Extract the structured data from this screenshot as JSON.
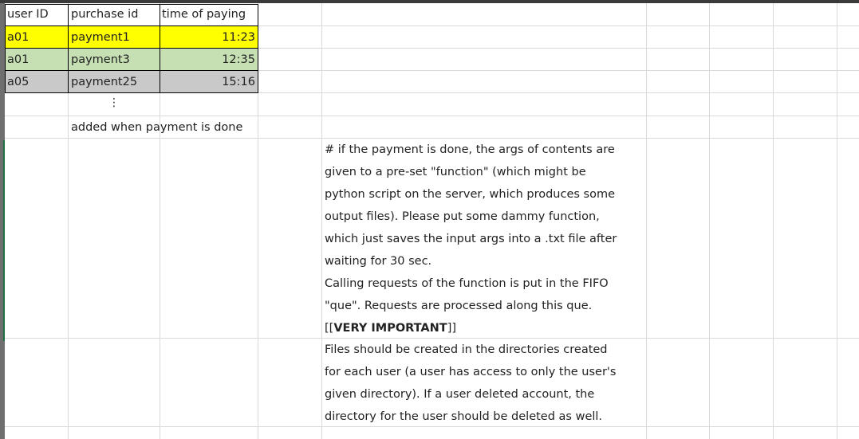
{
  "table": {
    "headers": [
      "user ID",
      "purchase id",
      "time of paying"
    ],
    "rows": [
      {
        "user": "a01",
        "purchase": "payment1",
        "time": "11:23",
        "fill": "#ffff00"
      },
      {
        "user": "a01",
        "purchase": "payment3",
        "time": "12:35",
        "fill": "#c6e0b4"
      },
      {
        "user": "a05",
        "purchase": "payment25",
        "time": "15:16",
        "fill": "#c9c9c9"
      }
    ],
    "ellipsis": "⋮",
    "note": "added when payment is done"
  },
  "description": {
    "lines": [
      "# if the payment is done, the args of contents are",
      "given to a pre-set \"function\" (which might be",
      "python script on the server, which produces some",
      "output files). Please put some dammy function,",
      "which just saves the input args into a .txt file after",
      "waiting for 30 sec.",
      "Calling requests of the function is put in the FIFO",
      "\"que\". Requests are processed along this que.",
      "[[",
      "VERY IMPORTANT",
      "]]",
      "Files should be created in the directories created",
      "for each user (a user has access to only the user's",
      "given directory). If a user deleted account, the",
      "directory for the user should be deleted as well."
    ]
  }
}
